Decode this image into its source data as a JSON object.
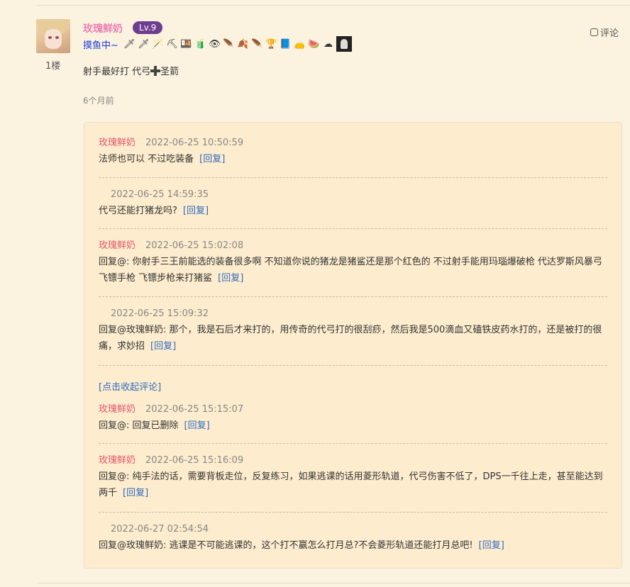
{
  "post": {
    "floor": "1楼",
    "username": "玫瑰鲜奶",
    "level": "Lv.9",
    "signature": "摸鱼中~",
    "comment_label": "评论",
    "body_before": "射手最好打 代弓",
    "body_after": "圣箭",
    "time": "6个月前",
    "badges": [
      "🗡",
      "🗡",
      "🪄",
      "⛏",
      "🍱",
      "🧃",
      "👁",
      "🪶",
      "🍂",
      "🪶",
      "🏆",
      "📘",
      "👝",
      "🍉",
      "☁"
    ]
  },
  "replies": [
    {
      "name": "玫瑰鲜奶",
      "date": "2022-06-25 10:50:59",
      "text": "法师也可以 不过吃装备",
      "reply": "[回复]"
    },
    {
      "name": "",
      "date": "2022-06-25 14:59:35",
      "text": "代弓还能打猪龙吗?",
      "reply": "[回复]"
    },
    {
      "name": "玫瑰鲜奶",
      "date": "2022-06-25 15:02:08",
      "text": "回复@: 你射手三王前能选的装备很多啊 不知道你说的猪龙是猪鲨还是那个红色的 不过射手能用玛瑙爆破枪 代达罗斯风暴弓 飞镖手枪 飞镖步枪来打猪鲨",
      "reply": "[回复]"
    },
    {
      "name": "",
      "date": "2022-06-25 15:09:32",
      "text": "回复@玫瑰鲜奶: 那个，我是石后才来打的，用传奇的代弓打的很刮痧，然后我是500滴血又磕铁皮药水打的，还是被打的很痛，求妙招",
      "reply": "[回复]"
    },
    {
      "name": "玫瑰鲜奶",
      "date": "2022-06-25 15:15:07",
      "text": "回复@: 回复已删除",
      "reply": "[回复]"
    },
    {
      "name": "玫瑰鲜奶",
      "date": "2022-06-25 15:16:09",
      "text": "回复@: 纯手法的话，需要背板走位，反复练习，如果逃课的话用菱形轨道，代弓伤害不低了，DPS一千往上走，甚至能达到两千",
      "reply": "[回复]"
    },
    {
      "name": "",
      "date": "2022-06-27 02:54:54",
      "text": "回复@玫瑰鲜奶: 逃课是不可能逃课的，这个打不赢怎么打月总?不会菱形轨道还能打月总吧!",
      "reply": "[回复]"
    }
  ],
  "collapse_label": "[点击收起评论]"
}
